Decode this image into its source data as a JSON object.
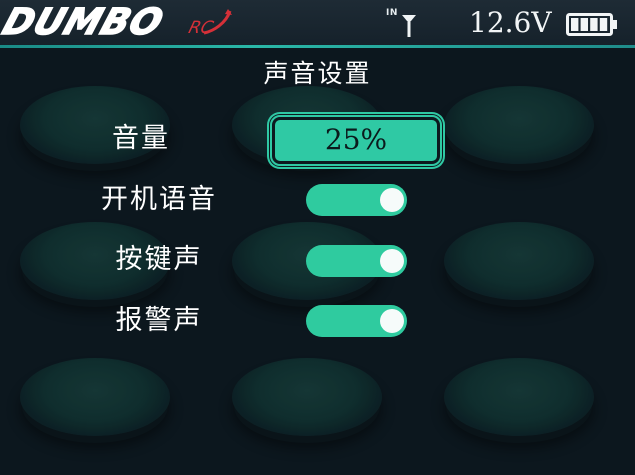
{
  "header": {
    "brand": "DUMBO",
    "brand_sub": "RC",
    "signal_label": "IN",
    "voltage": "12.6V",
    "battery_level": 1.0
  },
  "screen": {
    "title": "声音设置"
  },
  "settings": [
    {
      "label": "音量",
      "type": "value",
      "value": "25%"
    },
    {
      "label": "开机语音",
      "type": "toggle",
      "on": true
    },
    {
      "label": "按键声",
      "type": "toggle",
      "on": true
    },
    {
      "label": "报警声",
      "type": "toggle",
      "on": true
    }
  ],
  "colors": {
    "background": "#0c171e",
    "accent": "#2fcb9f",
    "brand_red": "#d43038",
    "header": "#1e2b35"
  }
}
